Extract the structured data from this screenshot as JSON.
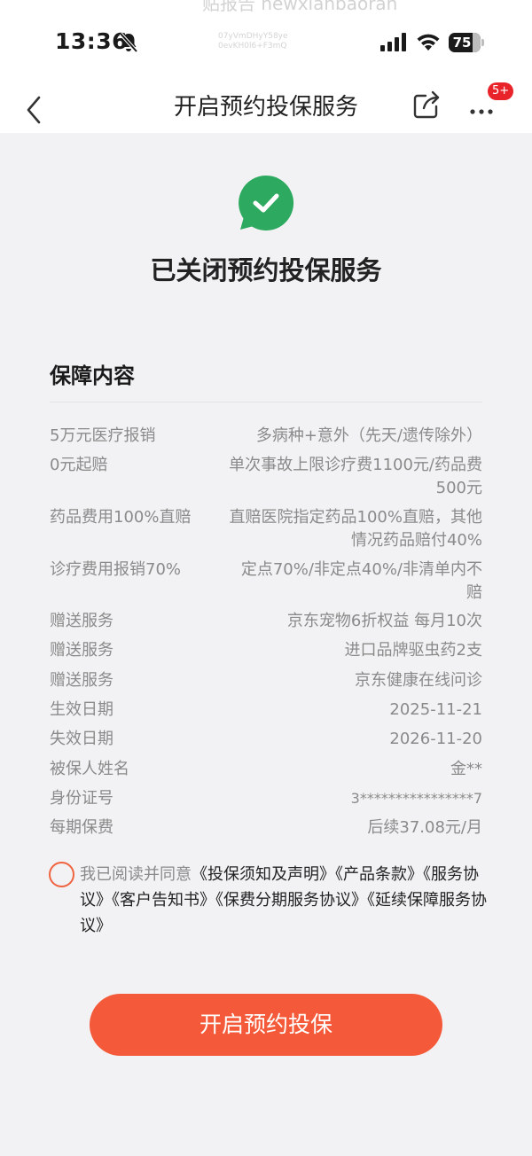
{
  "status_bar": {
    "time": "13:36",
    "battery": "75",
    "watermark_line1": "贴报告 newxianbaoran",
    "watermark_line2": "07yVmDHyY58ye",
    "watermark_line3": "0evKH0l6+F3mQ",
    "icons": [
      "bell-slash-icon",
      "signal-icon",
      "wifi-icon",
      "battery-icon"
    ]
  },
  "nav": {
    "title": "开启预约投保服务",
    "badge": "5+",
    "icons": [
      "back-chevron-icon",
      "share-icon",
      "more-dots-icon"
    ]
  },
  "status": {
    "title": "已关闭预约投保服务",
    "icon": "check-chat-bubble-icon",
    "icon_color": "#2daa5f"
  },
  "coverage": {
    "section_title": "保障内容",
    "rows": [
      {
        "label": "5万元医疗报销",
        "value": "多病种+意外（先天/遗传除外）"
      },
      {
        "label": "0元起赔",
        "value": "单次事故上限诊疗费1100元/药品费500元"
      },
      {
        "label": "药品费用100%直赔",
        "value": "直赔医院指定药品100%直赔，其他情况药品赔付40%"
      },
      {
        "label": "诊疗费用报销70%",
        "value": "定点70%/非定点40%/非清单内不赔"
      },
      {
        "label": "赠送服务",
        "value": "京东宠物6折权益 每月10次"
      },
      {
        "label": "赠送服务",
        "value": "进口品牌驱虫药2支"
      },
      {
        "label": "赠送服务",
        "value": "京东健康在线问诊"
      },
      {
        "label": "生效日期",
        "value": "2025-11-21"
      },
      {
        "label": "失效日期",
        "value": "2026-11-20"
      },
      {
        "label": "被保人姓名",
        "value": "金**"
      },
      {
        "label": "身份证号",
        "value": "3****************7"
      },
      {
        "label": "每期保费",
        "value": "后续37.08元/月"
      }
    ]
  },
  "agreement": {
    "prefix": "我已阅读并同意",
    "links": [
      "《投保须知及声明》",
      "《产品条款》",
      "《服务协议》",
      "《客户告知书》",
      "《保费分期服务协议》",
      "《延续保障服务协议》"
    ]
  },
  "cta": {
    "label": "开启预约投保",
    "color": "#f45a39"
  }
}
